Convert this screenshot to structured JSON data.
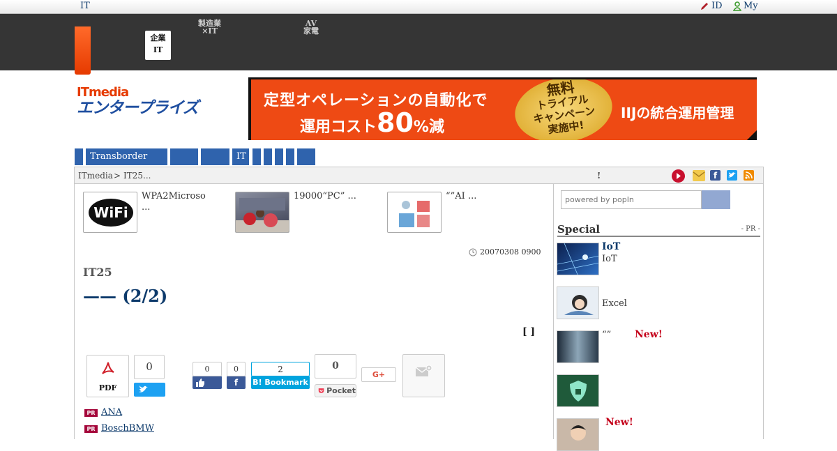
{
  "topstrip": {
    "brand": "IT",
    "login": "ID",
    "my": "My"
  },
  "nav": {
    "active_line1": "企業",
    "active_line2": "IT",
    "tab2_line1": "製造業",
    "tab2_line2": "×IT",
    "tab3_line1": "AV",
    "tab3_line2": "家電"
  },
  "logo": {
    "line1": "ITmedia",
    "line2": "エンタープライズ"
  },
  "banner": {
    "line1": "定型オペレーションの自動化で",
    "line2a": "運用コスト",
    "line2b": "80",
    "line2c": "%減",
    "seal1": "無料",
    "seal2": "トライアル",
    "seal3": "キャンペーン",
    "seal4": "実施中!",
    "line3": "IIJの統合運用管理"
  },
  "catnav": [
    "",
    "Transborder",
    "",
    "",
    "IT",
    "",
    "",
    "",
    ""
  ],
  "breadcrumb": {
    "root": "ITmedia",
    "sep": ">",
    "current": "IT25...",
    "mark": "!"
  },
  "related": [
    {
      "title": "WPA2Microso",
      "cont": "..."
    },
    {
      "title": "19000“PC” ..."
    },
    {
      "title": "“”AI ..."
    }
  ],
  "article": {
    "date": "20070308 0900",
    "series": "IT25",
    "headline": "—— (2/2)",
    "bracket": "[ ]"
  },
  "share": {
    "pdf": "PDF",
    "tweet_count": "0",
    "like_count": "0",
    "fb_count": "0",
    "hatena_count": "2",
    "hatena_label": "B! Bookmark",
    "pocket_count": "0",
    "pocket_label": "Pocket",
    "gplus": "G+"
  },
  "pr_links": [
    {
      "badge": "PR",
      "text": "ANA"
    },
    {
      "badge": "PR",
      "text": "BoschBMW"
    }
  ],
  "sidebar": {
    "search_placeholder": "powered by popIn",
    "special_title": "Special",
    "special_pr": "- PR -",
    "items": [
      {
        "title": "IoT",
        "sub": "IoT",
        "new": ""
      },
      {
        "title": "",
        "sub": "Excel",
        "new": ""
      },
      {
        "title": "“”",
        "sub": "",
        "new": "New!"
      },
      {
        "title": "",
        "sub": "",
        "new": ""
      },
      {
        "title": "",
        "sub": "",
        "new": "New!"
      }
    ]
  },
  "colors": {
    "nav_blue": "#2f63ad",
    "dark_bar": "#353535",
    "accent_orange": "#e63a00",
    "link_navy": "#0d3a6b"
  }
}
